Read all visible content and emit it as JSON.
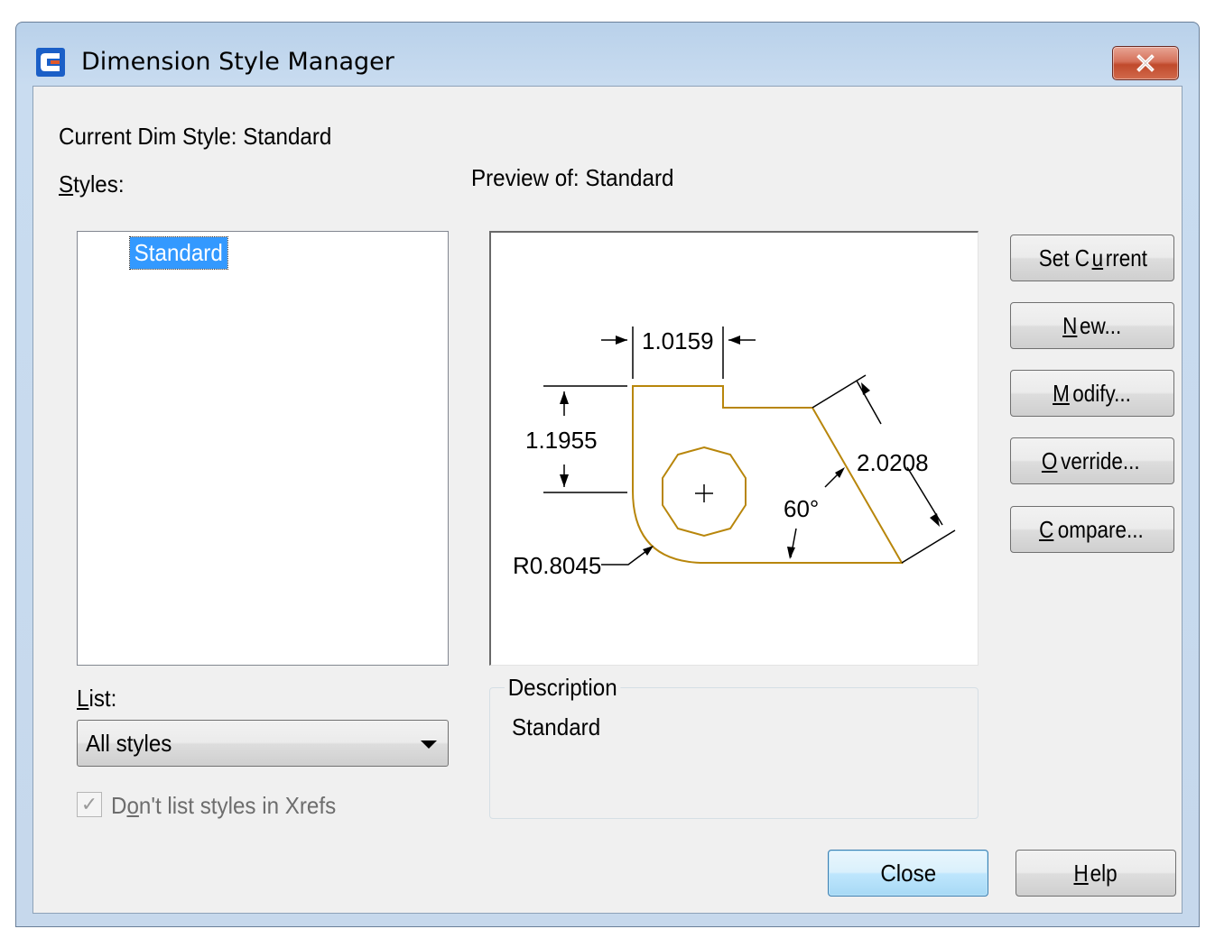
{
  "window": {
    "title": "Dimension Style Manager",
    "close_icon": "close-x-icon"
  },
  "current_style": {
    "label": "Current Dim Style: Standard"
  },
  "styles": {
    "label": "Styles:",
    "mnemonic": "S",
    "label_rest": "tyles:",
    "items": [
      "Standard"
    ],
    "selected": "Standard"
  },
  "preview": {
    "label": "Preview of: Standard",
    "dims": {
      "top": "1.0159",
      "left": "1.1955",
      "diagonal": "2.0208",
      "angle": "60°",
      "radius": "R0.8045"
    },
    "colors": {
      "shape": "#b8860b",
      "dims": "#000000"
    }
  },
  "buttons": {
    "set_current": {
      "pre": "Set C",
      "mn": "u",
      "post": "rrent"
    },
    "new": {
      "pre": "",
      "mn": "N",
      "post": "ew..."
    },
    "modify": {
      "pre": "",
      "mn": "M",
      "post": "odify..."
    },
    "override": {
      "pre": "",
      "mn": "O",
      "post": "verride..."
    },
    "compare": {
      "pre": "",
      "mn": "C",
      "post": "ompare..."
    },
    "close": {
      "label": "Close"
    },
    "help": {
      "pre": "",
      "mn": "H",
      "post": "elp"
    }
  },
  "list": {
    "label_mn": "L",
    "label_rest": "ist:",
    "selected": "All styles"
  },
  "xrefs": {
    "checked": true,
    "label_pre": "D",
    "label_mn": "o",
    "label_post": "n't list styles in Xrefs"
  },
  "description": {
    "legend": "Description",
    "text": "Standard"
  }
}
